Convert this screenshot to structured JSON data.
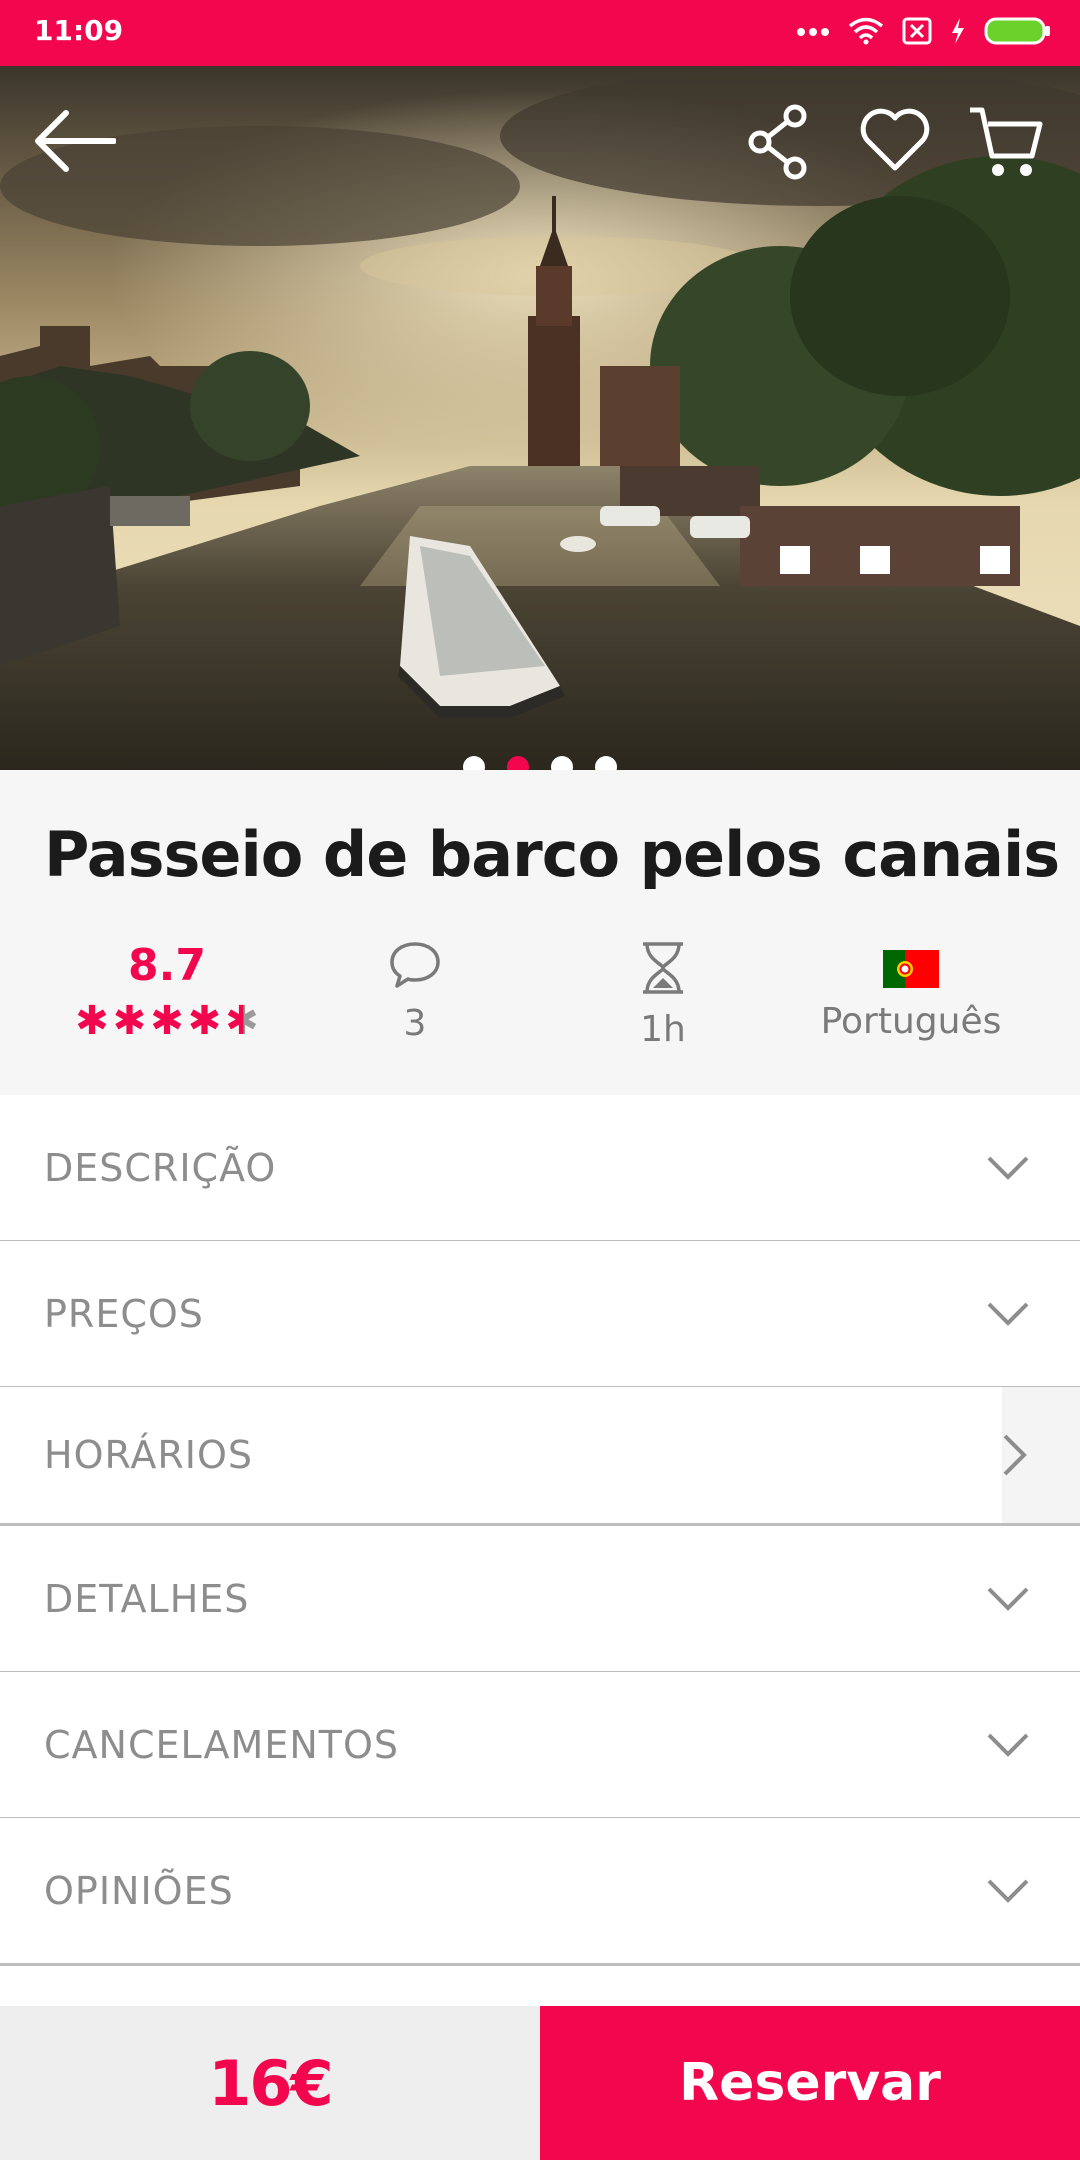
{
  "status": {
    "time": "11:09"
  },
  "hero": {
    "image_alt": "Amsterdam canal with tour boat and clock tower",
    "active_slide": 2,
    "slide_count": 4
  },
  "title": "Passeio de barco pelos canais",
  "rating": {
    "score": "8.7",
    "stars": 4.5
  },
  "reviews_count": "3",
  "duration": "1h",
  "language": "Português",
  "sections": [
    {
      "label": "DESCRIÇÃO",
      "icon": "chevron-down-icon"
    },
    {
      "label": "PREÇOS",
      "icon": "chevron-down-icon"
    },
    {
      "label": "HORÁRIOS",
      "icon": "chevron-right-icon"
    },
    {
      "label": "DETALHES",
      "icon": "chevron-down-icon"
    },
    {
      "label": "CANCELAMENTOS",
      "icon": "chevron-down-icon"
    },
    {
      "label": "OPINIÕES",
      "icon": "chevron-down-icon"
    }
  ],
  "bottom": {
    "price": "16€",
    "reserve_label": "Reservar"
  },
  "colors": {
    "accent": "#f2074f"
  }
}
